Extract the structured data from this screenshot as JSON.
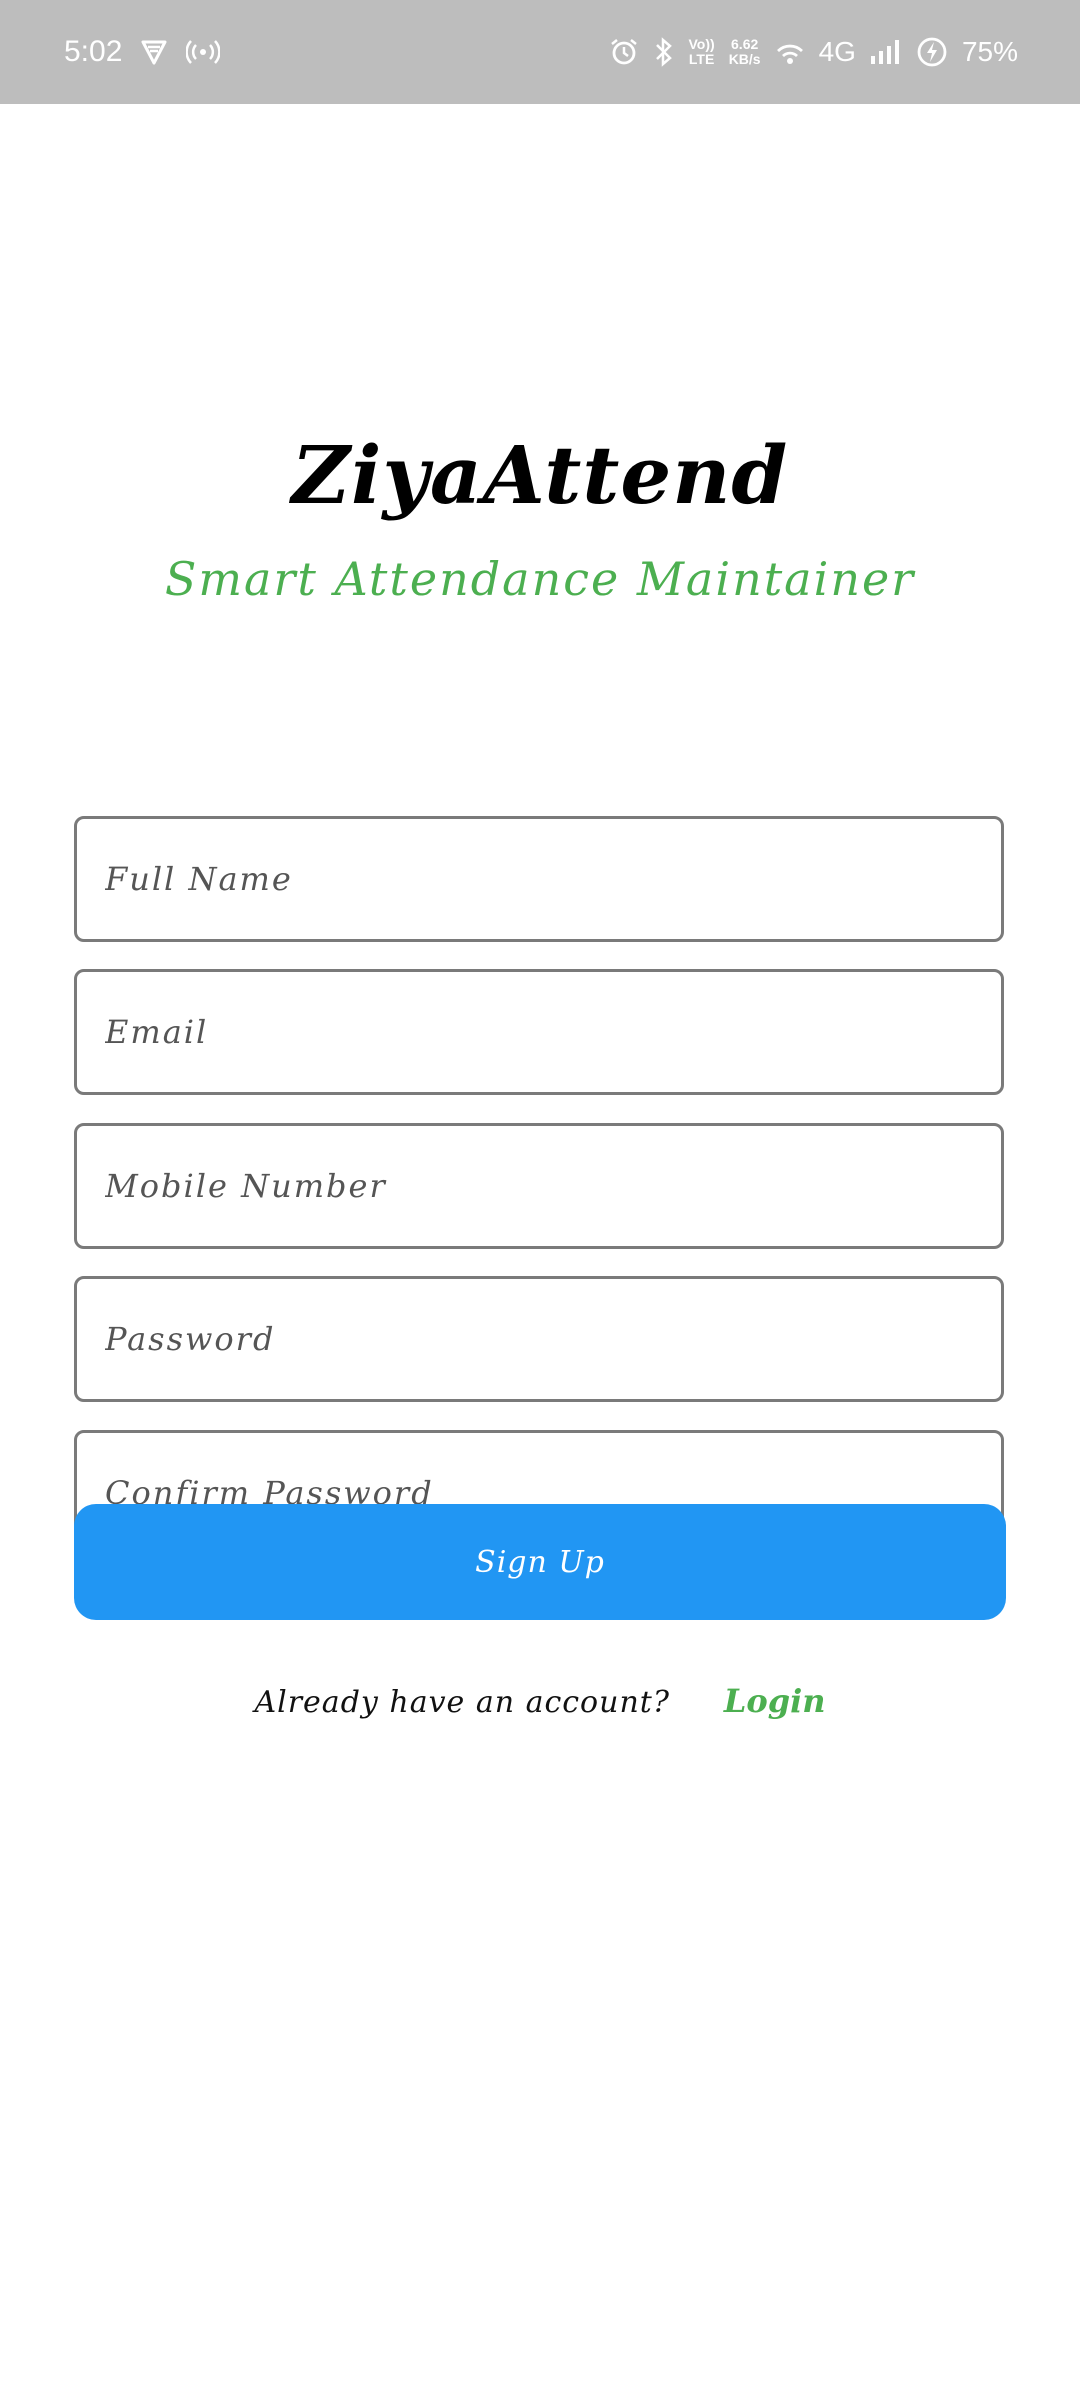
{
  "status_bar": {
    "time": "5:02",
    "network_speed_value": "6.62",
    "network_speed_unit": "KB/s",
    "volte_top": "Vo))",
    "volte_bottom": "LTE",
    "network_type": "4G",
    "battery_percent": "75%",
    "icons": [
      "vpn-shield-icon",
      "hotspot-icon",
      "alarm-icon",
      "bluetooth-icon",
      "volte-icon",
      "wifi-icon",
      "signal-icon",
      "battery-charging-icon"
    ]
  },
  "app": {
    "title": "ZiyaAttend",
    "subtitle": "Smart Attendance Maintainer",
    "accent_color": "#4caf50",
    "button_color": "#2196f3"
  },
  "form": {
    "full_name": {
      "placeholder": "Full Name",
      "value": ""
    },
    "email": {
      "placeholder": "Email",
      "value": ""
    },
    "mobile": {
      "placeholder": "Mobile Number",
      "value": ""
    },
    "password": {
      "placeholder": "Password",
      "value": ""
    },
    "confirm_password": {
      "placeholder": "Confirm Password",
      "value": ""
    },
    "signup_label": "Sign Up"
  },
  "footer": {
    "prompt": "Already have an account?",
    "login_label": "Login"
  }
}
